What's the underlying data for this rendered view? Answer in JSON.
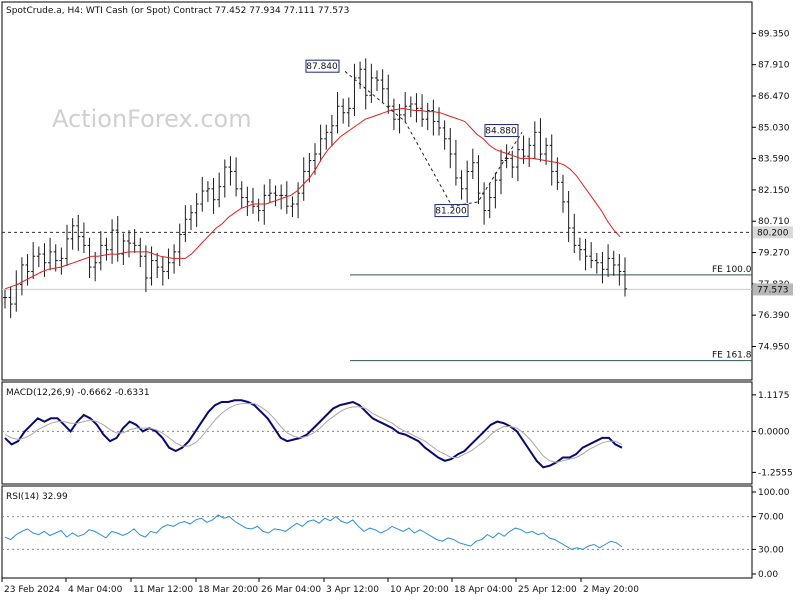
{
  "chart_data": {
    "type": "line",
    "header": "SpotCrude.a, H4:  WTI Cash (or Spot) Contract  77.452 77.934 77.111 77.573",
    "watermark": "ActionForex.com",
    "price_panel": {
      "y_ticks": [
        "89.350",
        "87.910",
        "86.470",
        "85.030",
        "83.590",
        "82.150",
        "80.710",
        "79.270",
        "77.830",
        "76.390",
        "74.950"
      ],
      "ylim": [
        73.5,
        90.7
      ],
      "current_price_label": "77.573",
      "current_price": 77.573,
      "resistance_label": "80.200",
      "resistance": 80.2,
      "fe_lines": [
        {
          "label": "FE 100.0",
          "value": 78.24
        },
        {
          "label": "FE 161.8",
          "value": 74.3
        }
      ],
      "annotations": [
        {
          "label": "87.840",
          "x": 43,
          "y": 87.84
        },
        {
          "label": "81.200",
          "x": 79,
          "y": 81.2
        },
        {
          "label": "84.880",
          "x": 88,
          "y": 84.88
        }
      ],
      "series": [
        {
          "type": "bar",
          "values": [
            77.2,
            76.9,
            77.8,
            78.7,
            78.4,
            79.1,
            79.2,
            78.8,
            79.3,
            78.9,
            79.0,
            79.9,
            80.5,
            80.0,
            79.6,
            78.6,
            78.8,
            79.6,
            79.4,
            80.3,
            79.2,
            79.8,
            79.7,
            79.6,
            79.1,
            78.1,
            78.9,
            78.6,
            78.4,
            78.8,
            79.3,
            80.1,
            80.8,
            81.1,
            81.5,
            82.1,
            82.2,
            81.7,
            82.3,
            83.2,
            83.0,
            82.2,
            81.8,
            81.6,
            81.4,
            81.2,
            81.9,
            82.0,
            81.9,
            81.9,
            81.4,
            81.5,
            82.0,
            83.0,
            83.5,
            83.8,
            84.5,
            84.8,
            85.1,
            86.0,
            85.7,
            85.9,
            87.3,
            87.7,
            86.5,
            87.3,
            87.2,
            86.8,
            86.0,
            85.4,
            85.6,
            86.0,
            86.1,
            85.9,
            85.4,
            85.8,
            85.3,
            85.0,
            84.5,
            83.8,
            82.7,
            82.2,
            83.0,
            83.4,
            82.0,
            81.2,
            81.8,
            82.6,
            83.5,
            83.6,
            83.2,
            84.0,
            83.7,
            84.2,
            84.8,
            83.8,
            84.2,
            83.0,
            82.5,
            81.6,
            80.4,
            79.6,
            79.4,
            79.1,
            78.9,
            78.8,
            78.5,
            79.0,
            78.7,
            78.4,
            77.6
          ]
        },
        {
          "type": "line",
          "values": [
            77.6,
            77.7,
            77.8,
            77.95,
            78.1,
            78.25,
            78.4,
            78.5,
            78.55,
            78.6,
            78.7,
            78.8,
            78.9,
            79.0,
            79.1,
            79.1,
            79.15,
            79.2,
            79.2,
            79.25,
            79.3,
            79.3,
            79.3,
            79.3,
            79.2,
            79.1,
            79.05,
            79.0,
            79.0,
            79.0,
            79.2,
            79.5,
            79.8,
            80.1,
            80.4,
            80.6,
            80.9,
            81.1,
            81.3,
            81.4,
            81.5,
            81.5,
            81.5,
            81.6,
            81.7,
            81.8,
            81.9,
            82.1,
            82.4,
            82.7,
            83.1,
            83.6,
            84.0,
            84.3,
            84.6,
            84.8,
            85.0,
            85.2,
            85.4,
            85.5,
            85.6,
            85.7,
            85.8,
            85.85,
            85.9,
            85.85,
            85.8,
            85.8,
            85.75,
            85.75,
            85.7,
            85.6,
            85.5,
            85.4,
            85.3,
            85.0,
            84.7,
            84.5,
            84.2,
            84.0,
            83.9,
            83.8,
            83.7,
            83.6,
            83.6,
            83.6,
            83.55,
            83.5,
            83.45,
            83.4,
            83.3,
            83.1,
            82.8,
            82.4,
            82.0,
            81.6,
            81.2,
            80.7,
            80.3,
            80.0
          ]
        }
      ]
    },
    "macd_panel": {
      "label": "MACD(12,26,9) -0.6662 -0.6331",
      "y_ticks": [
        "1.1175",
        "0.0000",
        "-1.2555"
      ],
      "ylim": [
        -1.55,
        1.45
      ],
      "series": [
        {
          "type": "line",
          "values": [
            -0.2,
            -0.4,
            -0.3,
            0.0,
            0.2,
            0.4,
            0.3,
            0.4,
            0.4,
            0.2,
            0.0,
            0.3,
            0.5,
            0.4,
            0.2,
            -0.1,
            -0.3,
            -0.2,
            0.1,
            0.3,
            0.2,
            0.0,
            0.1,
            0.0,
            -0.2,
            -0.5,
            -0.6,
            -0.5,
            -0.3,
            0.0,
            0.3,
            0.6,
            0.8,
            0.9,
            0.9,
            0.95,
            0.95,
            0.9,
            0.8,
            0.6,
            0.4,
            0.1,
            -0.2,
            -0.3,
            -0.25,
            -0.2,
            -0.1,
            0.1,
            0.3,
            0.5,
            0.7,
            0.8,
            0.85,
            0.9,
            0.8,
            0.6,
            0.4,
            0.3,
            0.2,
            0.1,
            -0.05,
            -0.1,
            -0.2,
            -0.3,
            -0.5,
            -0.65,
            -0.8,
            -0.9,
            -0.85,
            -0.7,
            -0.6,
            -0.4,
            -0.2,
            0.0,
            0.2,
            0.3,
            0.25,
            0.15,
            0.0,
            -0.3,
            -0.6,
            -0.9,
            -1.1,
            -1.05,
            -0.95,
            -0.8,
            -0.8,
            -0.7,
            -0.5,
            -0.4,
            -0.3,
            -0.2,
            -0.2,
            -0.4,
            -0.5
          ]
        },
        {
          "type": "line",
          "values": [
            -0.1,
            -0.2,
            -0.25,
            -0.2,
            -0.1,
            0.05,
            0.15,
            0.25,
            0.3,
            0.3,
            0.25,
            0.25,
            0.3,
            0.35,
            0.3,
            0.2,
            0.05,
            -0.05,
            -0.05,
            0.05,
            0.1,
            0.1,
            0.1,
            0.05,
            -0.05,
            -0.2,
            -0.35,
            -0.45,
            -0.45,
            -0.35,
            -0.15,
            0.1,
            0.35,
            0.55,
            0.7,
            0.8,
            0.85,
            0.85,
            0.85,
            0.75,
            0.6,
            0.4,
            0.15,
            -0.05,
            -0.15,
            -0.2,
            -0.15,
            -0.05,
            0.1,
            0.3,
            0.45,
            0.6,
            0.7,
            0.75,
            0.75,
            0.7,
            0.55,
            0.45,
            0.35,
            0.25,
            0.1,
            0.0,
            -0.1,
            -0.2,
            -0.3,
            -0.45,
            -0.6,
            -0.7,
            -0.8,
            -0.8,
            -0.7,
            -0.6,
            -0.45,
            -0.3,
            -0.1,
            0.05,
            0.15,
            0.15,
            0.1,
            -0.05,
            -0.25,
            -0.5,
            -0.75,
            -0.9,
            -0.95,
            -0.9,
            -0.85,
            -0.8,
            -0.7,
            -0.55,
            -0.45,
            -0.35,
            -0.3,
            -0.3,
            -0.4
          ]
        }
      ]
    },
    "rsi_panel": {
      "label": "RSI(14) 32.99",
      "y_ticks": [
        "100.00",
        "70.00",
        "30.00",
        "0.00"
      ],
      "ylim": [
        0,
        100
      ],
      "levels": [
        70,
        30
      ],
      "series": [
        {
          "type": "line",
          "values": [
            45,
            42,
            48,
            52,
            55,
            50,
            48,
            52,
            47,
            50,
            53,
            45,
            50,
            46,
            48,
            54,
            52,
            48,
            44,
            52,
            50,
            47,
            50,
            55,
            48,
            45,
            52,
            50,
            57,
            60,
            58,
            62,
            64,
            61,
            66,
            68,
            63,
            66,
            72,
            68,
            70,
            64,
            60,
            56,
            55,
            58,
            52,
            50,
            55,
            54,
            52,
            57,
            62,
            58,
            64,
            66,
            62,
            68,
            65,
            70,
            64,
            62,
            66,
            58,
            52,
            56,
            54,
            50,
            53,
            58,
            55,
            52,
            56,
            50,
            54,
            50,
            46,
            42,
            40,
            44,
            42,
            38,
            36,
            34,
            40,
            42,
            48,
            44,
            50,
            46,
            52,
            56,
            54,
            50,
            52,
            48,
            50,
            44,
            42,
            38,
            34,
            30,
            32,
            30,
            34,
            36,
            32,
            36,
            40,
            38,
            33
          ]
        }
      ]
    },
    "x_ticks": [
      "23 Feb 2024",
      "4 Mar 04:00",
      "11 Mar 12:00",
      "18 Mar 20:00",
      "26 Mar 04:00",
      "3 Apr 12:00",
      "10 Apr 20:00",
      "18 Apr 04:00",
      "25 Apr 12:00",
      "2 May 20:00"
    ],
    "colors": {
      "up_bar": "#1a1a1a",
      "ma_line": "#e02020",
      "macd_line": "#0a0a6e",
      "signal_line": "#a8a8a8",
      "rsi_line": "#2b8fd8",
      "grid": "#000000"
    }
  }
}
